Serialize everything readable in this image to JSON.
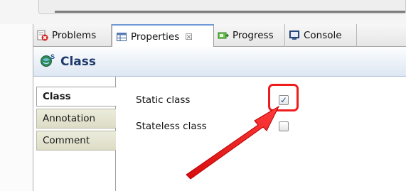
{
  "tabs": [
    {
      "label": "Problems",
      "icon": "problems-icon"
    },
    {
      "label": "Properties",
      "icon": "properties-icon",
      "active": true,
      "close": "☒"
    },
    {
      "label": "Progress",
      "icon": "progress-icon"
    },
    {
      "label": "Console",
      "icon": "console-icon"
    }
  ],
  "header": {
    "title": "Class",
    "icon_badge": "S"
  },
  "side_tabs": [
    {
      "label": "Class",
      "active": true
    },
    {
      "label": "Annotation"
    },
    {
      "label": "Comment"
    }
  ],
  "properties": [
    {
      "label": "Static class",
      "checked": true,
      "check_glyph": "✓"
    },
    {
      "label": "Stateless class",
      "checked": false
    }
  ],
  "colors": {
    "annotation_red": "#ee1c1c",
    "header_title": "#1f3a6a",
    "active_tab_accent": "#6f9ad6"
  }
}
